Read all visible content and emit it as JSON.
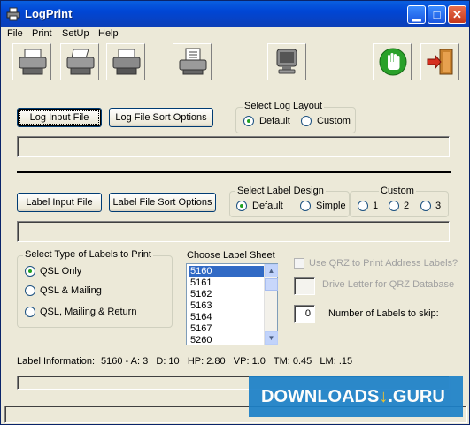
{
  "window": {
    "title": "LogPrint",
    "icon": "printer-icon"
  },
  "menu": [
    "File",
    "Print",
    "SetUp",
    "Help"
  ],
  "toolbar": [
    "printer-icon",
    "printer-icon",
    "printer-icon",
    "printer-icon",
    "monitor-icon",
    "stop-hand-icon",
    "exit-door-icon"
  ],
  "log": {
    "input_button": "Log Input File",
    "sort_button": "Log File Sort Options",
    "layout_group": "Select Log Layout",
    "layout_options": [
      "Default",
      "Custom"
    ],
    "layout_selected": "Default",
    "path": ""
  },
  "label": {
    "input_button": "Label Input File",
    "sort_button": "Label File Sort Options",
    "design_group": "Select Label Design",
    "design_options": [
      "Default",
      "Simple"
    ],
    "design_selected": "Default",
    "custom_group": "Custom",
    "custom_options": [
      "1",
      "2",
      "3"
    ],
    "path": ""
  },
  "label_types": {
    "group": "Select Type of Labels to Print",
    "options": [
      "QSL Only",
      "QSL & Mailing",
      "QSL, Mailing & Return"
    ],
    "selected": "QSL Only"
  },
  "label_sheet": {
    "heading": "Choose Label Sheet",
    "items": [
      "5160",
      "5161",
      "5162",
      "5163",
      "5164",
      "5167",
      "5260"
    ],
    "selected": "5160"
  },
  "qrz": {
    "checkbox_label": "Use QRZ to Print Address Labels?",
    "drive_label": "Drive Letter for QRZ Database",
    "drive_value": ""
  },
  "skip": {
    "label": "Number of Labels to skip:",
    "value": "0"
  },
  "info": {
    "label": "Label Information:",
    "values": "5160 - A: 3   D: 10   HP: 2.80   VP: 1.0   TM: 0.45   LM: .15"
  },
  "watermark": {
    "text": "DOWNLOADS",
    "symbol": "↓",
    "suffix": ".GURU"
  }
}
